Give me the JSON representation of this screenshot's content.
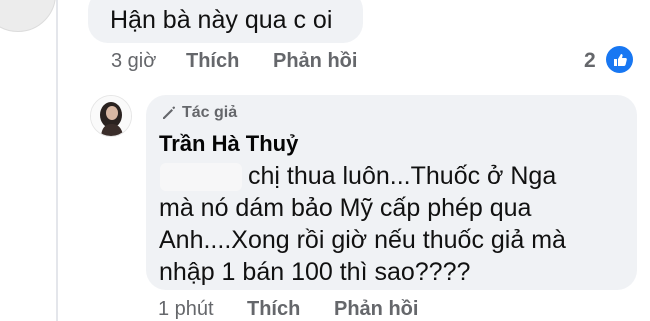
{
  "comment_top": {
    "text": "Hận bà này qua c oi",
    "time": "3 giờ",
    "like_label": "Thích",
    "reply_label": "Phản hồi",
    "reaction_count": "2"
  },
  "comment_reply": {
    "author_badge": "Tác giả",
    "author_name": "Trần Hà Thuỷ",
    "lines": [
      "chị thua luôn...Thuốc ở Nga",
      "mà nó dám bảo Mỹ cấp phép qua",
      "Anh....Xong rồi giờ nếu thuốc giả mà",
      "nhập 1 bán 100 thì sao????"
    ],
    "time": "1 phút",
    "like_label": "Thích",
    "reply_label": "Phản hồi"
  },
  "colors": {
    "like_blue": "#1877f2",
    "bubble_bg": "#f0f2f5",
    "meta_gray": "#65676b"
  }
}
